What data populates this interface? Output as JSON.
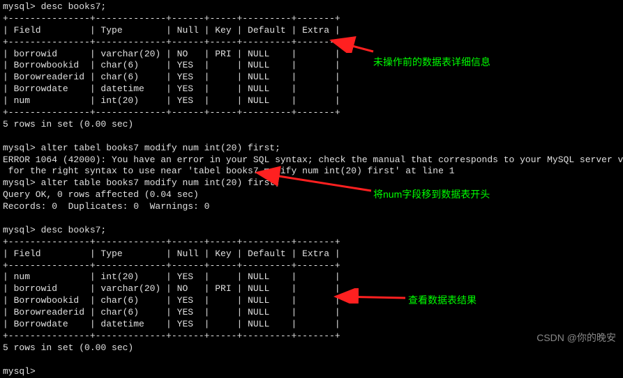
{
  "commands": {
    "c1": "mysql> desc books7;",
    "c2": "mysql> alter tabel books7 modify num int(20) first;",
    "c3": "mysql> alter table books7 modify num int(20) first;",
    "c4": "mysql> desc books7;",
    "c5": "mysql> "
  },
  "errors": {
    "e1a": "ERROR 1064 (42000): You have an error in your SQL syntax; check the manual that corresponds to your MySQL server version",
    "e1b": " for the right syntax to use near 'tabel books7 modify num int(20) first' at line 1"
  },
  "results": {
    "ok": "Query OK, 0 rows affected (0.04 sec)",
    "rec": "Records: 0  Duplicates: 0  Warnings: 0",
    "rows": "5 rows in set (0.00 sec)"
  },
  "table1": {
    "sep": "+---------------+-------------+------+-----+---------+-------+",
    "head": "| Field         | Type        | Null | Key | Default | Extra |",
    "r1": "| borrowid      | varchar(20) | NO   | PRI | NULL    |       |",
    "r2": "| Borrowbookid  | char(6)     | YES  |     | NULL    |       |",
    "r3": "| Borowreaderid | char(6)     | YES  |     | NULL    |       |",
    "r4": "| Borrowdate    | datetime    | YES  |     | NULL    |       |",
    "r5": "| num           | int(20)     | YES  |     | NULL    |       |"
  },
  "table2": {
    "sep": "+---------------+-------------+------+-----+---------+-------+",
    "head": "| Field         | Type        | Null | Key | Default | Extra |",
    "r1": "| num           | int(20)     | YES  |     | NULL    |       |",
    "r2": "| borrowid      | varchar(20) | NO   | PRI | NULL    |       |",
    "r3": "| Borrowbookid  | char(6)     | YES  |     | NULL    |       |",
    "r4": "| Borowreaderid | char(6)     | YES  |     | NULL    |       |",
    "r5": "| Borrowdate    | datetime    | YES  |     | NULL    |       |"
  },
  "annotations": {
    "a1": "未操作前的数据表详细信息",
    "a2": "将num字段移到数据表开头",
    "a3": "查看数据表结果"
  },
  "watermark": "CSDN @你的晚安"
}
